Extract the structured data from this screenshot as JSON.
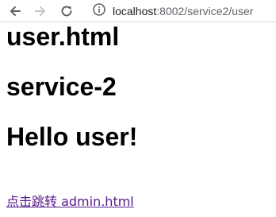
{
  "browser": {
    "url_host": "localhost",
    "url_rest": ":8002/service2/user",
    "icons": [
      "back-arrow-icon",
      "forward-arrow-icon",
      "reload-icon",
      "info-icon"
    ]
  },
  "page": {
    "heading_1": "user.html",
    "heading_2": "service-2",
    "heading_3": "Hello user!",
    "link_text": "点击跳转 admin.html"
  },
  "colors": {
    "link_visited": "#551a8b",
    "toolbar_icon": "#5f6368",
    "toolbar_icon_disabled": "#c4c7c5"
  }
}
